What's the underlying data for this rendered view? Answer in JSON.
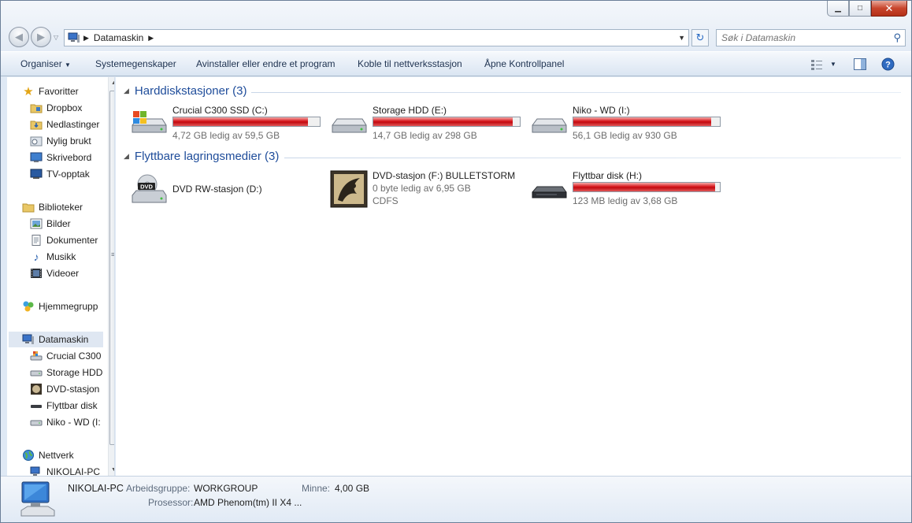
{
  "address": {
    "path": "Datamaskin"
  },
  "search": {
    "placeholder": "Søk i Datamaskin"
  },
  "toolbar": {
    "organize": "Organiser",
    "system_props": "Systemegenskaper",
    "uninstall": "Avinstaller eller endre et program",
    "map_drive": "Koble til nettverksstasjon",
    "control_panel": "Åpne Kontrollpanel"
  },
  "nav": {
    "favorites": "Favoritter",
    "dropbox": "Dropbox",
    "downloads": "Nedlastinger",
    "recent": "Nylig brukt",
    "desktop": "Skrivebord",
    "tv": "TV-opptak",
    "libraries": "Biblioteker",
    "pictures": "Bilder",
    "documents": "Dokumenter",
    "music": "Musikk",
    "videos": "Videoer",
    "homegroup": "Hjemmegrupp",
    "computer": "Datamaskin",
    "crucial": "Crucial C300",
    "storage": "Storage HDD",
    "dvd": "DVD-stasjon",
    "removable": "Flyttbar disk",
    "niko": "Niko - WD (I:",
    "network": "Nettverk",
    "nikolai": "NIKOLAI-PC"
  },
  "groups": {
    "hdd": "Harddiskstasjoner (3)",
    "removable": "Flyttbare lagringsmedier (3)"
  },
  "drives": {
    "c": {
      "name": "Crucial C300 SSD (C:)",
      "free": "4,72 GB ledig av 59,5 GB",
      "used_fraction": 0.92
    },
    "e": {
      "name": "Storage HDD (E:)",
      "free": "14,7 GB ledig av 298 GB",
      "used_fraction": 0.95
    },
    "i": {
      "name": "Niko - WD (I:)",
      "free": "56,1 GB ledig av 930 GB",
      "used_fraction": 0.94
    },
    "d": {
      "name": "DVD RW-stasjon (D:)"
    },
    "f": {
      "name": "DVD-stasjon (F:) BULLETSTORM",
      "free": "0 byte ledig av 6,95 GB",
      "fs": "CDFS"
    },
    "h": {
      "name": "Flyttbar disk (H:)",
      "free": "123 MB ledig av 3,68 GB",
      "used_fraction": 0.97
    }
  },
  "details": {
    "pc_name": "NIKOLAI-PC",
    "workgroup_label": "Arbeidsgruppe:",
    "workgroup": "WORKGROUP",
    "memory_label": "Minne:",
    "memory": "4,00 GB",
    "cpu_label": "Prosessor:",
    "cpu": "AMD Phenom(tm) II X4 ..."
  },
  "colors": {
    "bar_red": "#d7181d",
    "group_blue": "#1e4c9a"
  }
}
